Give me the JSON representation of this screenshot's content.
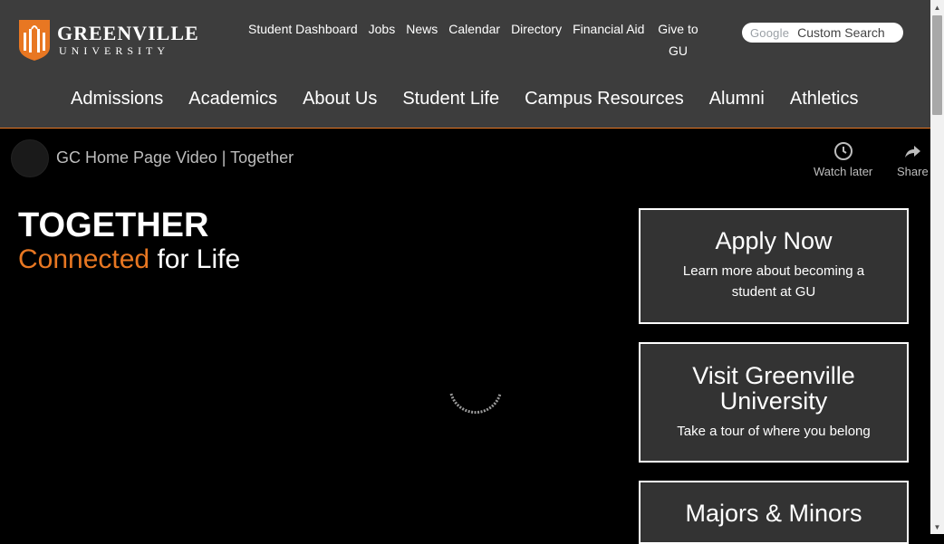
{
  "logo": {
    "line1": "GREENVILLE",
    "line2": "UNIVERSITY"
  },
  "util_nav": [
    "Student Dashboard",
    "Jobs",
    "News",
    "Calendar",
    "Directory",
    "Financial Aid"
  ],
  "give": {
    "line1": "Give to",
    "line2": "GU"
  },
  "search": {
    "brand": "Google",
    "placeholder": "Custom Search"
  },
  "main_nav": [
    "Admissions",
    "Academics",
    "About Us",
    "Student Life",
    "Campus Resources",
    "Alumni",
    "Athletics"
  ],
  "video": {
    "title": "GC Home Page Video | Together",
    "watch_later": "Watch later",
    "share": "Share"
  },
  "headline": {
    "line1": "TOGETHER",
    "accent": "Connected",
    "rest": " for Life"
  },
  "cards": [
    {
      "title": "Apply Now",
      "desc": "Learn more about becoming a student at GU"
    },
    {
      "title": "Visit Greenville University",
      "desc": "Take a tour of where you belong"
    },
    {
      "title": "Majors & Minors",
      "desc": ""
    }
  ],
  "colors": {
    "accent": "#e87722",
    "header_bg": "#3d3d3d",
    "card_bg": "#333333"
  }
}
